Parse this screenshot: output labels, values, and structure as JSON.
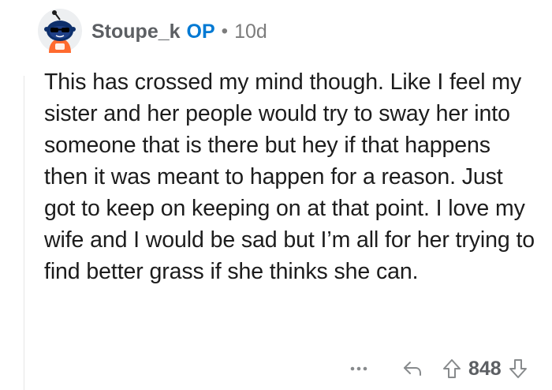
{
  "comment": {
    "author": "Stoupe_k",
    "op_badge": "OP",
    "separator": "•",
    "age": "10d",
    "avatar_icon": "snoo-sunglasses-avatar-icon",
    "body": "This has crossed my mind though. Like I feel my sister and her people would try to sway her into someone that is there but hey if that happens then it was meant to happen for a reason. Just got to keep on keeping on at that point. I love my wife and I would be sad but I’m all for her trying to find better grass if she thinks she can.",
    "actions": {
      "more_icon": "more-options-icon",
      "reply_icon": "reply-icon",
      "upvote_icon": "upvote-arrow-icon",
      "score": "848",
      "downvote_icon": "downvote-arrow-icon"
    }
  },
  "colors": {
    "username": "#5c5f63",
    "op_badge": "#0079d3",
    "body_text": "#1c1c1c",
    "meta_gray": "#7c7c7c",
    "thread_line": "#e6e6e6"
  }
}
